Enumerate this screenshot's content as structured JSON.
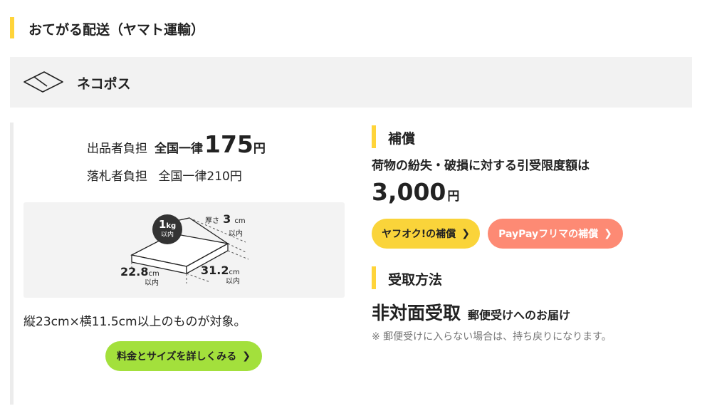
{
  "section_title": "おてがる配送（ヤマト運輸）",
  "method": {
    "icon": "envelope-icon",
    "name": "ネコポス"
  },
  "pricing": {
    "seller_label": "出品者負担",
    "seller_prefix": "全国一律",
    "seller_amount": "175",
    "seller_unit": "円",
    "buyer_label": "落札者負担",
    "buyer_text": "全国一律210円"
  },
  "illustration": {
    "weight_value": "1",
    "weight_unit": "kg",
    "weight_sub": "以内",
    "thickness_label": "厚さ",
    "thickness_value": "3",
    "thickness_unit": "cm",
    "thickness_sub": "以内",
    "width_value": "22.8",
    "width_unit": "cm",
    "width_sub": "以内",
    "length_value": "31.2",
    "length_unit": "cm",
    "length_sub": "以内"
  },
  "size_note": "縦23cm×横11.5cm以上のものが対象。",
  "detail_button": {
    "label": "料金とサイズを詳しくみる",
    "color": "#a3e03c"
  },
  "compensation": {
    "title": "補償",
    "desc": "荷物の紛失・破損に対する引受限度額は",
    "amount": "3,000",
    "unit": "円",
    "yafuoku_button": {
      "label": "ヤフオク!の補償",
      "color": "#fad43a"
    },
    "paypay_button": {
      "label": "PayPayフリマの補償",
      "color": "#fd8a74"
    }
  },
  "receipt": {
    "title": "受取方法",
    "method": "非対面受取",
    "method_sub": "郵便受けへのお届け",
    "note": "※ 郵便受けに入らない場合は、持ち戻りになります。"
  },
  "colors": {
    "accent_bar": "#ffd43a",
    "band_bg": "#f2f2f2",
    "illus_bg": "#f3f3f3"
  }
}
